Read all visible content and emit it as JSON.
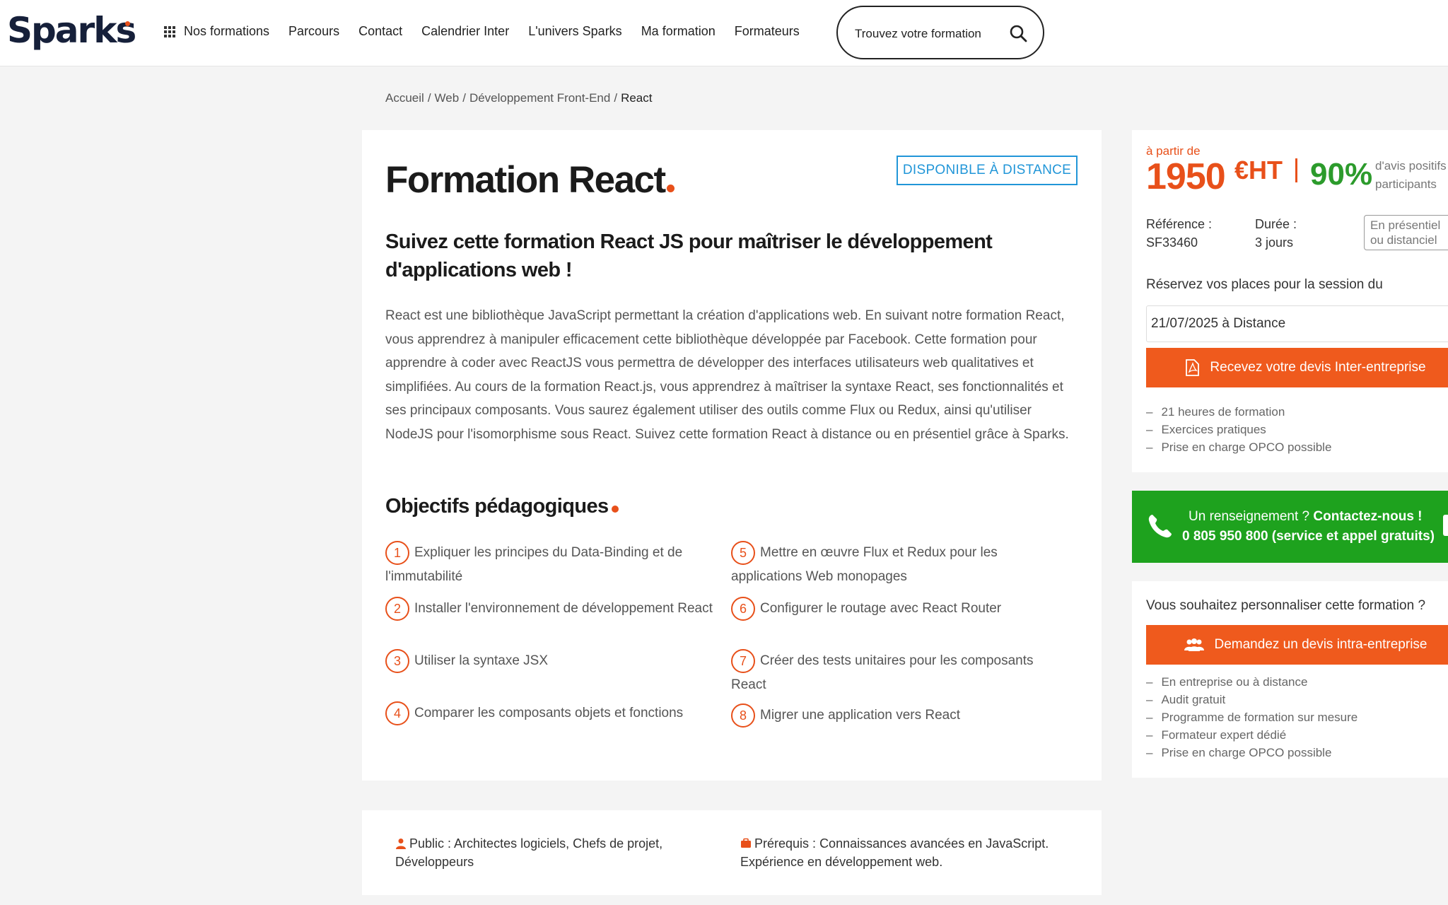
{
  "header": {
    "logo": "Sparks",
    "nav": [
      "Nos formations",
      "Parcours",
      "Contact",
      "Calendrier Inter",
      "L'univers Sparks",
      "Ma formation",
      "Formateurs"
    ],
    "search_placeholder": "Trouvez votre formation"
  },
  "breadcrumb": [
    "Accueil",
    "Web",
    "Développement Front-End",
    "React"
  ],
  "main": {
    "title": "Formation React",
    "badge": "DISPONIBLE À DISTANCE",
    "subtitle": "Suivez cette formation React JS pour maîtriser le développement d'applications web !",
    "description": "React est une bibliothèque JavaScript permettant la création d'applications web. En suivant notre formation React, vous apprendrez à manipuler efficacement cette bibliothèque développée par Facebook. Cette formation pour apprendre à coder avec ReactJS vous permettra de développer des interfaces utilisateurs web qualitatives et simplifiées. Au cours de la formation React.js, vous apprendrez à maîtriser la syntaxe React, ses fonctionnalités et ses principaux composants. Vous saurez également utiliser des outils comme Flux ou Redux, ainsi qu'utiliser NodeJS pour l'isomorphisme sous React. Suivez cette formation React à distance ou en présentiel grâce à Sparks.",
    "objectives_title": "Objectifs pédagogiques",
    "objectives": [
      {
        "num": "1",
        "text": "Expliquer les principes du Data-Binding et de l'immutabilité"
      },
      {
        "num": "2",
        "text": "Installer l'environnement de développement React"
      },
      {
        "num": "3",
        "text": "Utiliser la syntaxe JSX"
      },
      {
        "num": "4",
        "text": "Comparer les composants objets et fonctions"
      },
      {
        "num": "5",
        "text": "Mettre en œuvre Flux et Redux pour les applications Web monopages"
      },
      {
        "num": "6",
        "text": "Configurer le routage avec React Router"
      },
      {
        "num": "7",
        "text": "Créer des tests unitaires pour les composants React"
      },
      {
        "num": "8",
        "text": "Migrer une application vers React"
      }
    ]
  },
  "info": {
    "public_label": "Public",
    "public_value": "Architectes logiciels, Chefs de projet, Développeurs",
    "prereq_label": "Prérequis",
    "prereq_value": "Connaissances avancées en JavaScript. Expérience en développement web."
  },
  "sidebar": {
    "from_label": "à partir de",
    "price": "1950",
    "currency": "€HT",
    "rating_pct": "90%",
    "rating_l1": "d'avis positifs",
    "rating_l2": "participants",
    "ref_label": "Référence :",
    "ref_value": "SF33460",
    "duration_label": "Durée :",
    "duration_value": "3 jours",
    "mode_l1": "En présentiel",
    "mode_l2": "ou distanciel",
    "reserve_label": "Réservez vos places pour la session du",
    "session_value": "21/07/2025 à Distance",
    "inter_button": "Recevez votre devis Inter-entreprise",
    "inter_features": [
      "21 heures de formation",
      "Exercices pratiques",
      "Prise en charge OPCO possible"
    ],
    "contact_q": "Un renseignement ?",
    "contact_cta": "Contactez-nous !",
    "contact_phone": "0 805 950 800 (service et appel gratuits)",
    "custom_title": "Vous souhaitez personnaliser cette formation ?",
    "intra_button": "Demandez un devis intra-entreprise",
    "intra_features": [
      "En entreprise ou à distance",
      "Audit gratuit",
      "Programme de formation sur mesure",
      "Formateur expert dédié",
      "Prise en charge OPCO possible"
    ]
  },
  "colors": {
    "accent": "#e8501a",
    "button": "#ef5a1d",
    "green": "#1ea21e",
    "badge_blue": "#2196d8"
  }
}
